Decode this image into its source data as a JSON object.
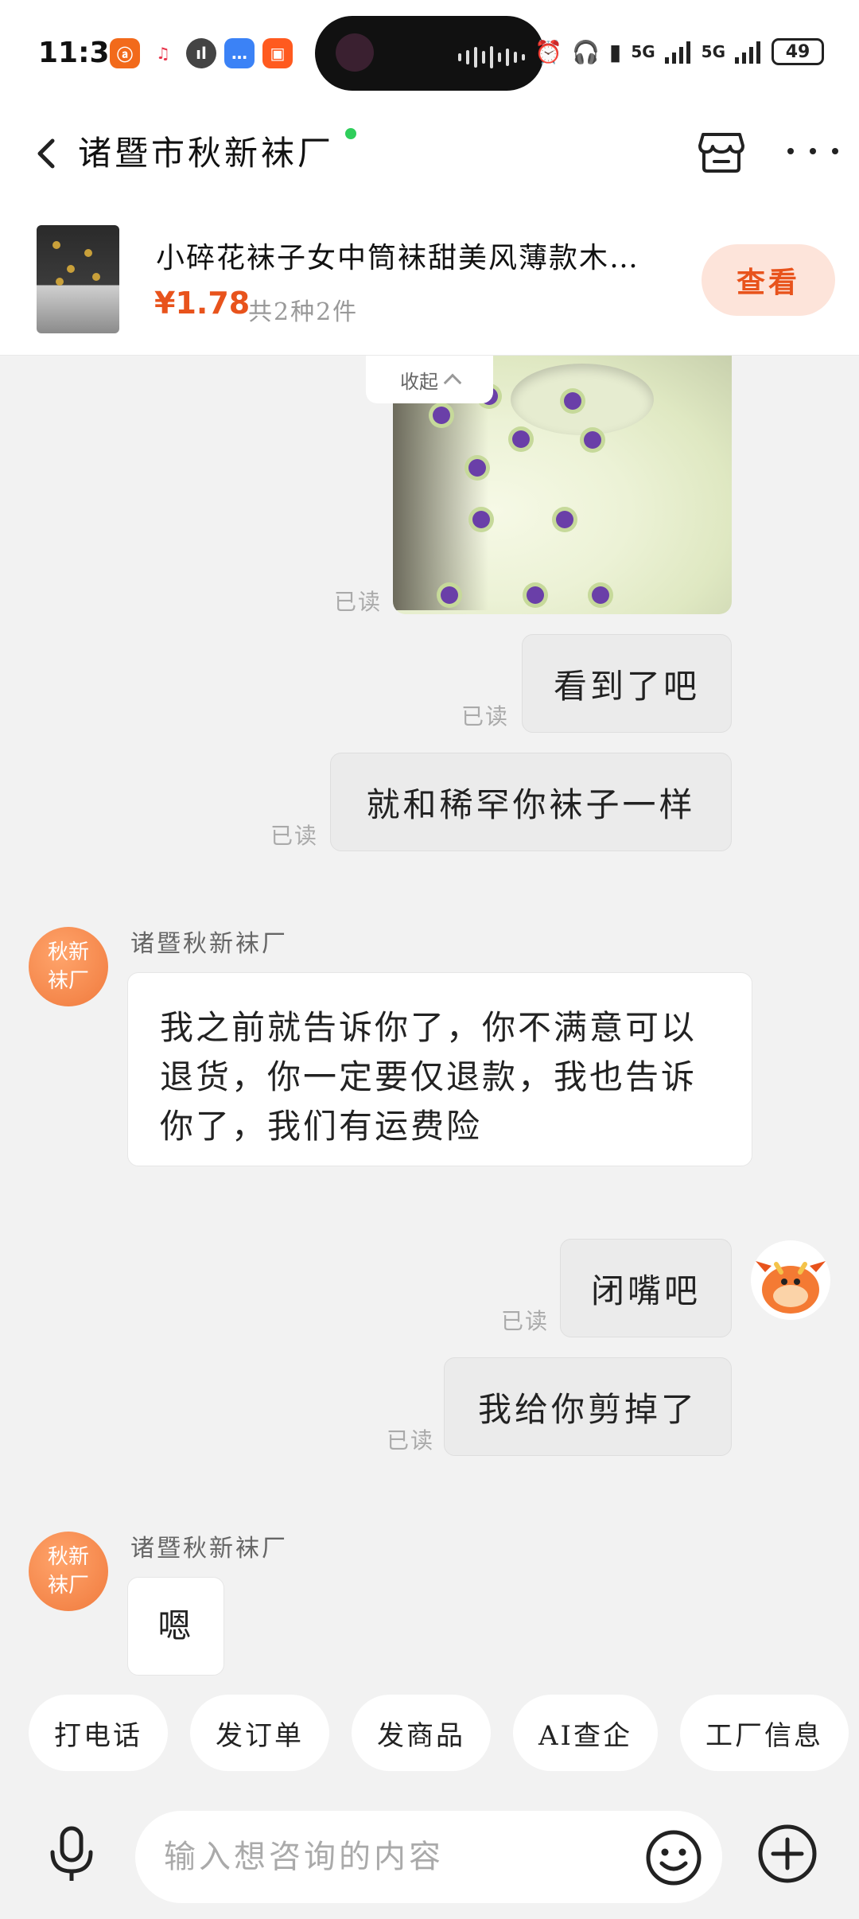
{
  "status_bar": {
    "time": "11:39",
    "network_1": "5G",
    "network_2": "5G",
    "battery": "49",
    "app_icons": [
      "1688-icon",
      "music-icon",
      "voice-icon",
      "message-icon",
      "kuaishou-icon"
    ]
  },
  "header": {
    "shop_name": "诸暨市秋新袜厂",
    "online": true
  },
  "product": {
    "title": "小碎花袜子女中筒袜甜美风薄款木…",
    "price": "¥1.78",
    "count": "共2种2件",
    "view_label": "查看"
  },
  "chat": {
    "collapse_label": "收起",
    "read_label": "已读",
    "messages": [
      {
        "from": "me",
        "type": "image"
      },
      {
        "from": "me",
        "text": "看到了吧"
      },
      {
        "from": "me",
        "text": "就和稀罕你袜子一样"
      },
      {
        "from": "shop",
        "sender": "诸暨秋新袜厂",
        "avatar": "秋新袜厂",
        "text": "我之前就告诉你了，你不满意可以退货，你一定要仅退款，我也告诉你了，我们有运费险"
      },
      {
        "from": "me",
        "text": "闭嘴吧"
      },
      {
        "from": "me",
        "text": "我给你剪掉了"
      },
      {
        "from": "shop",
        "sender": "诸暨秋新袜厂",
        "avatar": "秋新袜厂",
        "text": "嗯"
      }
    ]
  },
  "avatar_shop": {
    "line1": "秋新",
    "line2": "袜厂"
  },
  "quick_actions": [
    "打电话",
    "发订单",
    "发商品",
    "AI查企",
    "工厂信息"
  ],
  "input": {
    "placeholder": "输入想咨询的内容"
  },
  "colors": {
    "accent": "#e8531c",
    "online": "#2fce5b",
    "avatar_orange": "#f07a3d"
  }
}
